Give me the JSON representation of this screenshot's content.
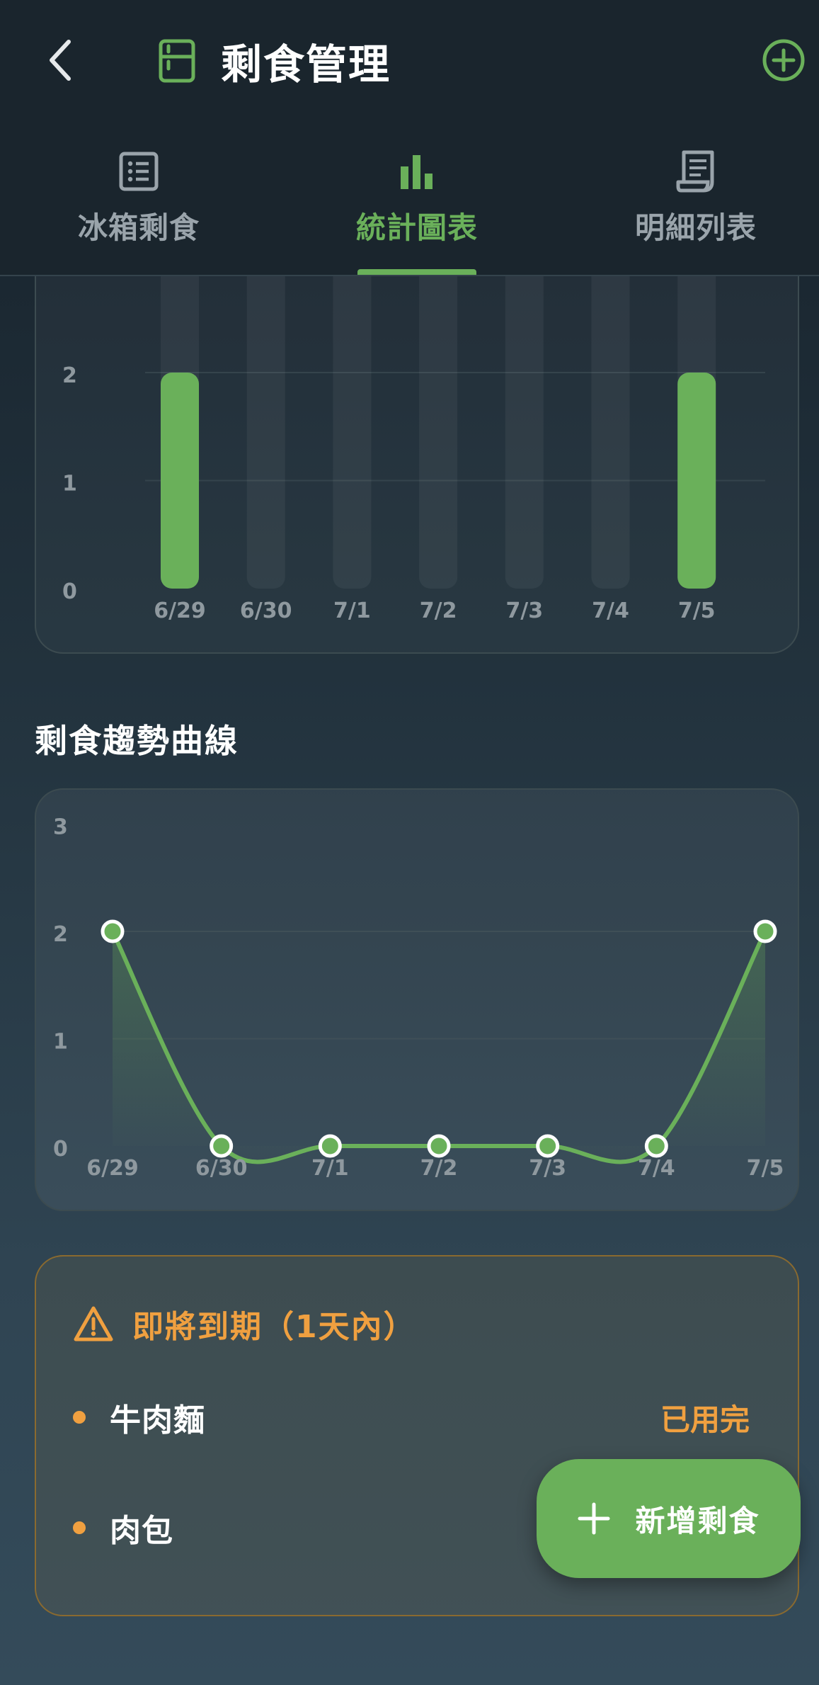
{
  "header": {
    "title": "剩食管理",
    "back_icon": "back-arrow-icon",
    "title_icon": "fridge-icon",
    "add_icon": "add-circle-icon"
  },
  "tabs": [
    {
      "label": "冰箱剩食",
      "icon": "list-icon",
      "active": false
    },
    {
      "label": "統計圖表",
      "icon": "bar-chart-icon",
      "active": true
    },
    {
      "label": "明細列表",
      "icon": "receipt-icon",
      "active": false
    }
  ],
  "sections": {
    "trend_title": "剩食趨勢曲線"
  },
  "chart_data": [
    {
      "type": "bar",
      "categories": [
        "6/29",
        "6/30",
        "7/1",
        "7/2",
        "7/3",
        "7/4",
        "7/5"
      ],
      "values": [
        2,
        0,
        0,
        0,
        0,
        0,
        2
      ],
      "yticks": [
        "0",
        "1",
        "2"
      ],
      "ylim": [
        0,
        2
      ],
      "grid": true,
      "color": "#6ab05a"
    },
    {
      "type": "line",
      "categories": [
        "6/29",
        "6/30",
        "7/1",
        "7/2",
        "7/3",
        "7/4",
        "7/5"
      ],
      "values": [
        2,
        0,
        0,
        0,
        0,
        0,
        2
      ],
      "yticks": [
        "0",
        "1",
        "2",
        "3"
      ],
      "ylim": [
        0,
        3
      ],
      "grid": true,
      "color": "#6ab05a"
    }
  ],
  "warning": {
    "title": "即將到期（1天內）",
    "icon": "warning-triangle-icon",
    "items": [
      {
        "name": "牛肉麵",
        "action": "已用完"
      },
      {
        "name": "肉包"
      }
    ]
  },
  "fab": {
    "label": "新增剩食",
    "icon": "plus-icon"
  },
  "colors": {
    "accent": "#6ab05a",
    "warning": "#f0a040",
    "header_bg": "#1a252d"
  }
}
